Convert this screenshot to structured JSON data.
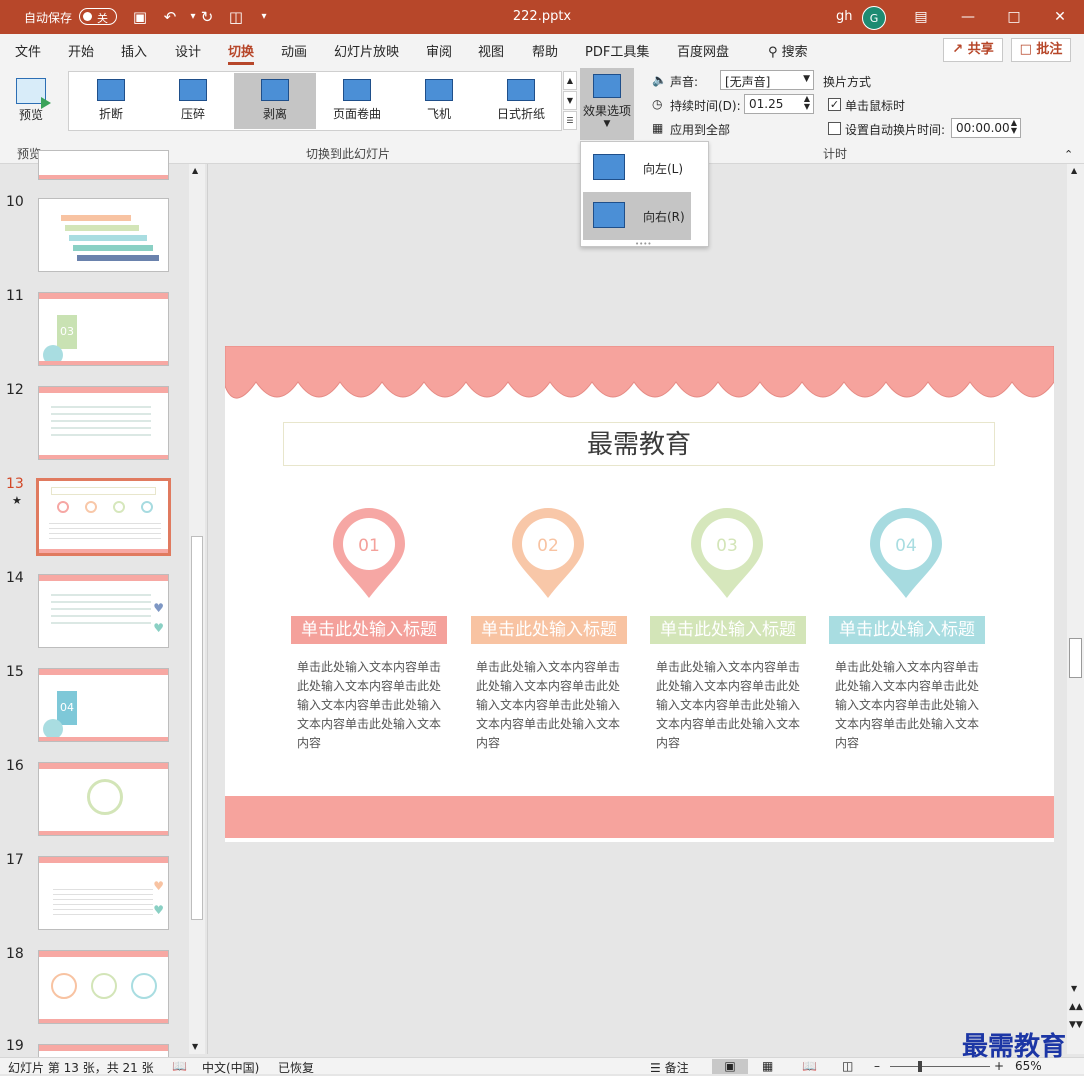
{
  "titlebar": {
    "autosave_label": "自动保存",
    "autosave_state": "关",
    "filename": "222.pptx",
    "user": "gh",
    "avatar": "G"
  },
  "tabs": [
    "文件",
    "开始",
    "插入",
    "设计",
    "切换",
    "动画",
    "幻灯片放映",
    "审阅",
    "视图",
    "帮助",
    "PDF工具集",
    "百度网盘"
  ],
  "active_tab": "切换",
  "search_label": "搜索",
  "share_label": "共享",
  "comment_label": "批注",
  "ribbon": {
    "preview_label": "预览",
    "preview_group": "预览",
    "transitions_group": "切换到此幻灯片",
    "transitions": [
      "折断",
      "压碎",
      "剥离",
      "页面卷曲",
      "飞机",
      "日式折纸"
    ],
    "selected_transition": "剥离",
    "effect_options": "效果选项",
    "sound_label": "声音:",
    "sound_value": "[无声音]",
    "duration_label": "持续时间(D):",
    "duration_value": "01.25",
    "apply_all": "应用到全部",
    "advance_label": "换片方式",
    "on_click": "单击鼠标时",
    "auto_after": "设置自动换片时间:",
    "auto_after_value": "00:00.00",
    "timing_group": "计时"
  },
  "effect_dropdown": {
    "items": [
      "向左(L)",
      "向右(R)"
    ],
    "selected": "向右(R)"
  },
  "thumbnails": {
    "numbers": [
      "10",
      "11",
      "12",
      "13",
      "14",
      "15",
      "16",
      "17",
      "18",
      "19"
    ],
    "active": "13",
    "star": "★",
    "thumb_11_num": "03",
    "thumb_15_num": "04"
  },
  "slide": {
    "title": "最需教育",
    "columns": [
      {
        "num": "01",
        "title": "单击此处输入标题",
        "body": "单击此处输入文本内容单击此处输入文本内容单击此处输入文本内容单击此处输入文本内容单击此处输入文本内容",
        "color": "#f4a19b",
        "pin_color": "#f6a7a4"
      },
      {
        "num": "02",
        "title": "单击此处输入标题",
        "body": "单击此处输入文本内容单击此处输入文本内容单击此处输入文本内容单击此处输入文本内容单击此处输入文本内容",
        "color": "#f8c3a2",
        "pin_color": "#f8c7a8"
      },
      {
        "num": "03",
        "title": "单击此处输入标题",
        "body": "单击此处输入文本内容单击此处输入文本内容单击此处输入文本内容单击此处输入文本内容单击此处输入文本内容",
        "color": "#d3e5b8",
        "pin_color": "#d6e7bc"
      },
      {
        "num": "04",
        "title": "单击此处输入标题",
        "body": "单击此处输入文本内容单击此处输入文本内容单击此处输入文本内容单击此处输入文本内容单击此处输入文本内容",
        "color": "#a9dde1",
        "pin_color": "#a7dbe0"
      }
    ]
  },
  "statusbar": {
    "slide_info": "幻灯片 第 13 张，共 21 张",
    "language": "中文(中国)",
    "recovered": "已恢复",
    "notes": "备注",
    "zoom": "65%"
  },
  "watermark": "最需教育",
  "colors": {
    "accent": "#b7472a",
    "awning": "#f6a39d"
  }
}
